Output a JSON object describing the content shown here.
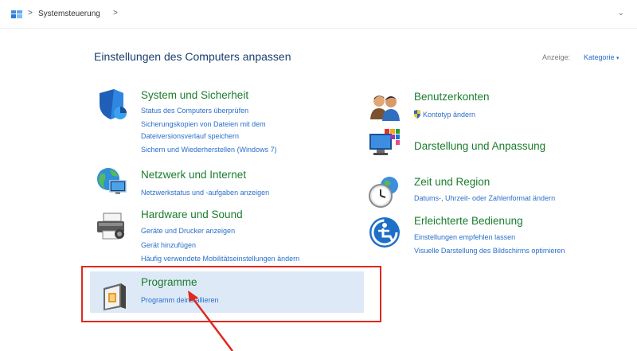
{
  "address_bar": {
    "path": "Systemsteuerung",
    "chevron": ">"
  },
  "header": {
    "title": "Einstellungen des Computers anpassen",
    "view_label": "Anzeige:",
    "view_value": "Kategorie"
  },
  "categories": {
    "system": {
      "title": "System und Sicherheit",
      "links": [
        "Status des Computers überprüfen",
        "Sicherungskopien von Dateien mit dem",
        "Dateiversionsverlauf speichern",
        "Sichern und Wiederherstellen (Windows 7)"
      ]
    },
    "network": {
      "title": "Netzwerk und Internet",
      "links": [
        "Netzwerkstatus und -aufgaben anzeigen"
      ]
    },
    "hardware": {
      "title": "Hardware und Sound",
      "links": [
        "Geräte und Drucker anzeigen",
        "Gerät hinzufügen",
        "Häufig verwendete Mobilitätseinstellungen ändern"
      ]
    },
    "programs": {
      "title": "Programme",
      "links": [
        "Programm deinstallieren"
      ]
    },
    "accounts": {
      "title": "Benutzerkonten",
      "links": [
        "Kontotyp ändern"
      ]
    },
    "appearance": {
      "title": "Darstellung und Anpassung",
      "links": []
    },
    "clock": {
      "title": "Zeit und Region",
      "links": [
        "Datums-, Uhrzeit- oder Zahlenformat ändern"
      ]
    },
    "ease": {
      "title": "Erleichterte Bedienung",
      "links": [
        "Einstellungen empfehlen lassen",
        "Visuelle Darstellung des Bildschirms optimieren"
      ]
    }
  },
  "icons": {
    "system": "shield-icon",
    "network": "globe-network-icon",
    "hardware": "printer-icon",
    "programs": "programs-box-icon",
    "accounts": "users-icon",
    "appearance": "monitor-palette-icon",
    "clock": "clock-globe-icon",
    "ease": "accessibility-icon"
  },
  "colors": {
    "title_green": "#1b7d2e",
    "link_blue": "#2a6fc9",
    "highlight_bg": "#dde9f6",
    "annotation_red": "#e0281e"
  }
}
